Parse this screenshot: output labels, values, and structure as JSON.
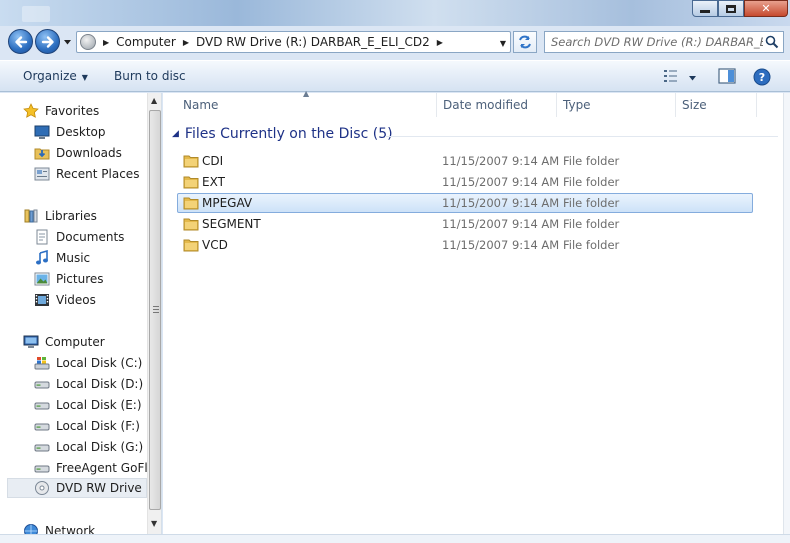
{
  "window": {
    "minimize_label": "minimize",
    "maximize_label": "maximize",
    "close_label": "close"
  },
  "address": {
    "crumbs": [
      "Computer",
      "DVD RW Drive (R:) DARBAR_E_ELI_CD2"
    ],
    "search_placeholder": "Search DVD RW Drive (R:) DARBAR_E..."
  },
  "toolbar": {
    "organize_label": "Organize",
    "burn_label": "Burn to disc"
  },
  "nav": {
    "favorites": {
      "label": "Favorites",
      "items": [
        "Desktop",
        "Downloads",
        "Recent Places"
      ]
    },
    "libraries": {
      "label": "Libraries",
      "items": [
        "Documents",
        "Music",
        "Pictures",
        "Videos"
      ]
    },
    "computer": {
      "label": "Computer",
      "items": [
        "Local Disk (C:)",
        "Local Disk (D:)",
        "Local Disk (E:)",
        "Local Disk (F:)",
        "Local Disk (G:)",
        "FreeAgent GoFlex",
        "DVD RW Drive (R:"
      ]
    },
    "network_label": "Network"
  },
  "columns": [
    "Name",
    "Date modified",
    "Type",
    "Size"
  ],
  "group": {
    "title": "Files Currently on the Disc (5)"
  },
  "files": [
    {
      "name": "CDI",
      "date": "11/15/2007 9:14 AM",
      "type": "File folder"
    },
    {
      "name": "EXT",
      "date": "11/15/2007 9:14 AM",
      "type": "File folder"
    },
    {
      "name": "MPEGAV",
      "date": "11/15/2007 9:14 AM",
      "type": "File folder"
    },
    {
      "name": "SEGMENT",
      "date": "11/15/2007 9:14 AM",
      "type": "File folder"
    },
    {
      "name": "VCD",
      "date": "11/15/2007 9:14 AM",
      "type": "File folder"
    }
  ],
  "colors": {
    "accent": "#1e3287",
    "selection": "#cde2f8"
  }
}
